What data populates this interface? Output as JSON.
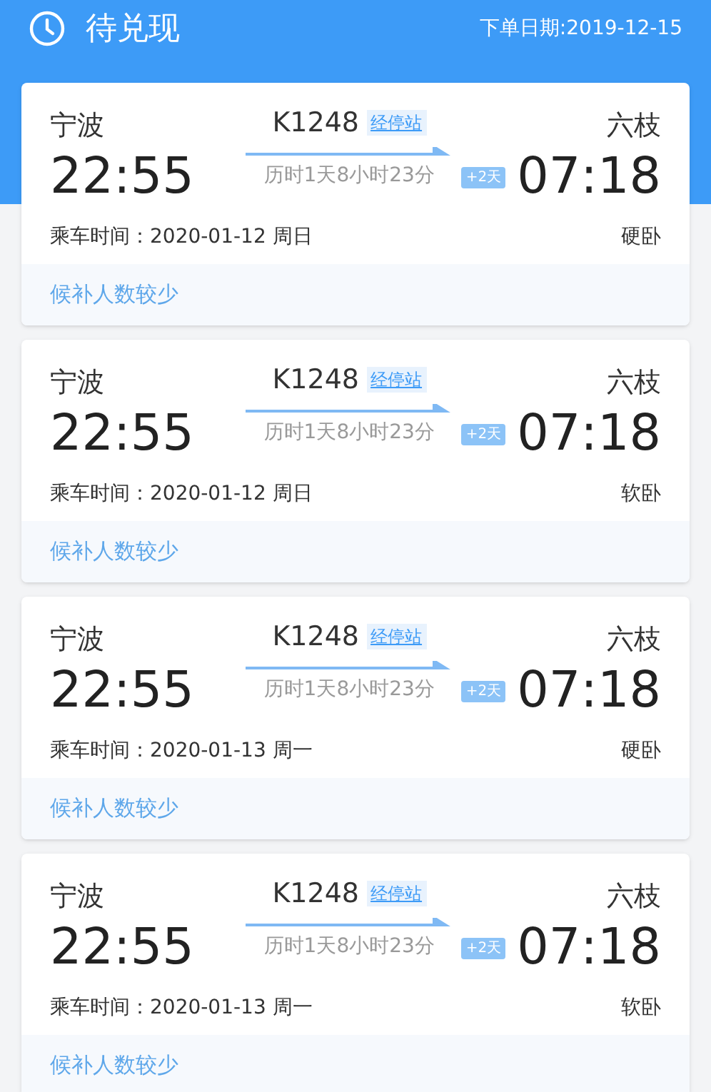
{
  "header": {
    "title": "待兑现",
    "order_date": "下单日期:2019-12-15"
  },
  "tickets": [
    {
      "from": "宁波",
      "depart": "22:55",
      "train": "K1248",
      "stops_link": "经停站",
      "duration": "历时1天8小时23分",
      "day_offset": "+2天",
      "to": "六枝",
      "arrive": "07:18",
      "ride_time": "乘车时间：2020-01-12 周日",
      "seat": "硬卧",
      "note": "候补人数较少"
    },
    {
      "from": "宁波",
      "depart": "22:55",
      "train": "K1248",
      "stops_link": "经停站",
      "duration": "历时1天8小时23分",
      "day_offset": "+2天",
      "to": "六枝",
      "arrive": "07:18",
      "ride_time": "乘车时间：2020-01-12 周日",
      "seat": "软卧",
      "note": "候补人数较少"
    },
    {
      "from": "宁波",
      "depart": "22:55",
      "train": "K1248",
      "stops_link": "经停站",
      "duration": "历时1天8小时23分",
      "day_offset": "+2天",
      "to": "六枝",
      "arrive": "07:18",
      "ride_time": "乘车时间：2020-01-13 周一",
      "seat": "硬卧",
      "note": "候补人数较少"
    },
    {
      "from": "宁波",
      "depart": "22:55",
      "train": "K1248",
      "stops_link": "经停站",
      "duration": "历时1天8小时23分",
      "day_offset": "+2天",
      "to": "六枝",
      "arrive": "07:18",
      "ride_time": "乘车时间：2020-01-13 周一",
      "seat": "软卧",
      "note": "候补人数较少"
    }
  ]
}
